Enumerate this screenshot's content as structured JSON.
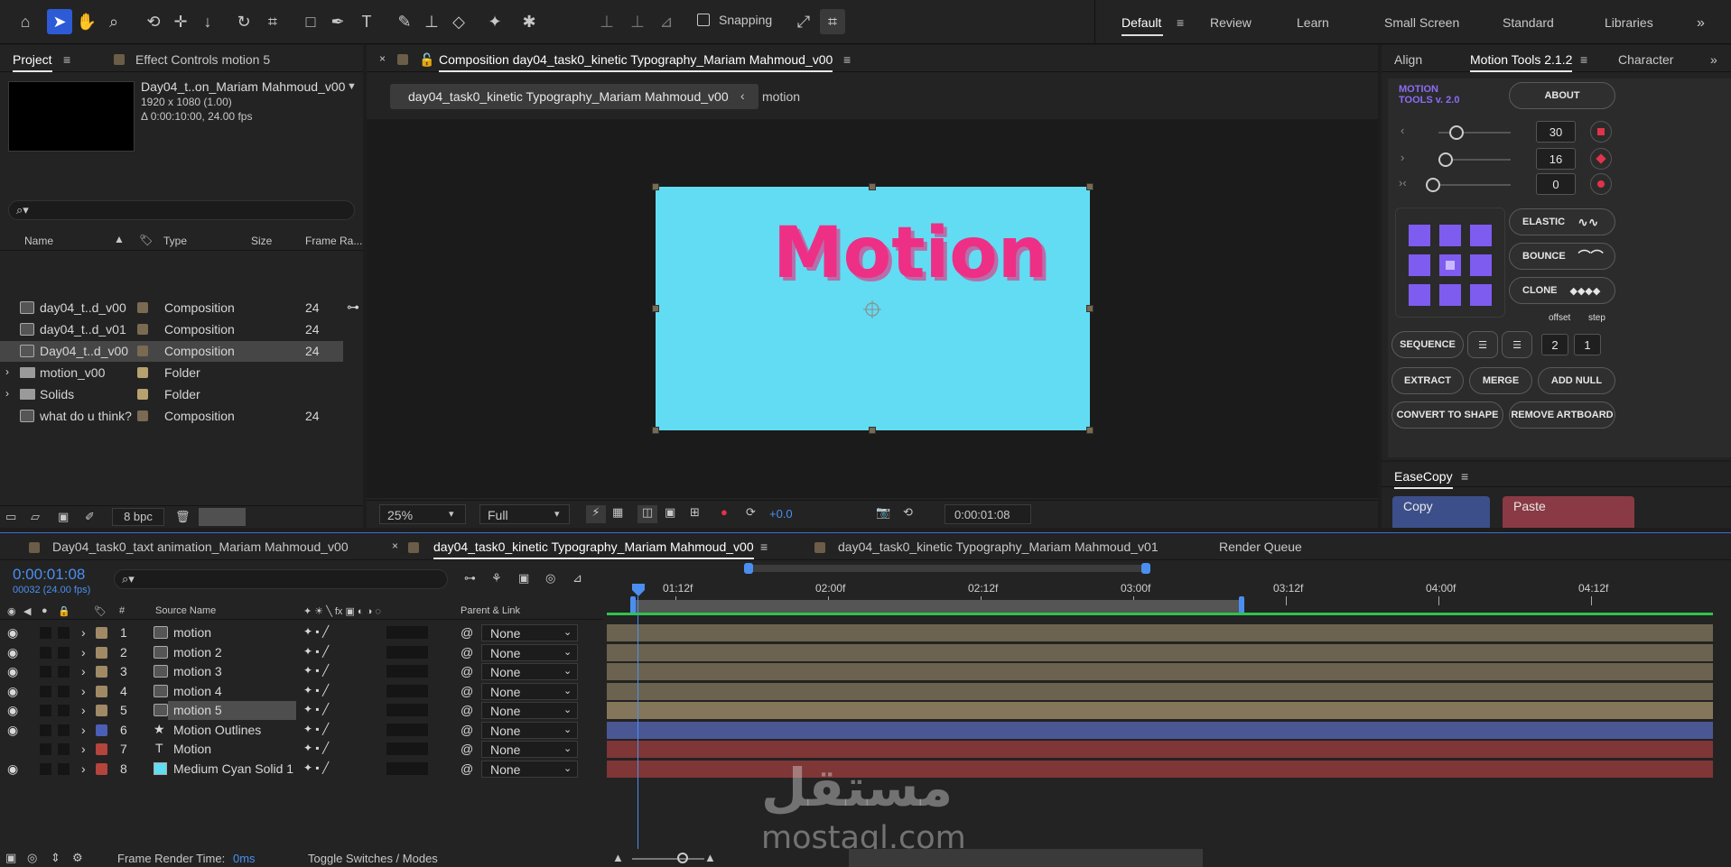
{
  "toolbar": {
    "snapping_label": "Snapping",
    "workspaces": [
      "Default",
      "Review",
      "Learn",
      "Small Screen",
      "Standard",
      "Libraries"
    ],
    "active_workspace": "Default"
  },
  "project": {
    "tabs": [
      "Project",
      "Effect Controls motion 5"
    ],
    "preview_name": "Day04_t..on_Mariam Mahmoud_v00",
    "preview_dims": "1920 x 1080 (1.00)",
    "preview_duration": "Δ 0:00:10:00, 24.00 fps",
    "search_placeholder": "",
    "columns": [
      "Name",
      "Type",
      "Size",
      "Frame Ra..."
    ],
    "items": [
      {
        "name": "day04_t..d_v00",
        "type": "Composition",
        "rate": "24",
        "kind": "comp",
        "color": "#7a6a52"
      },
      {
        "name": "day04_t..d_v01",
        "type": "Composition",
        "rate": "24",
        "kind": "comp",
        "color": "#7a6a52"
      },
      {
        "name": "Day04_t..d_v00",
        "type": "Composition",
        "rate": "24",
        "kind": "comp",
        "color": "#7a6a52",
        "selected": true
      },
      {
        "name": "motion_v00",
        "type": "Folder",
        "rate": "",
        "kind": "folder",
        "color": "#b7a26f"
      },
      {
        "name": "Solids",
        "type": "Folder",
        "rate": "",
        "kind": "folder",
        "color": "#b7a26f"
      },
      {
        "name": "what do u think?",
        "type": "Composition",
        "rate": "24",
        "kind": "comp",
        "color": "#7a6a52"
      }
    ],
    "bpc": "8 bpc"
  },
  "comp": {
    "panel_title": "Composition day04_task0_kinetic Typography_Mariam Mahmoud_v00",
    "breadcrumb_active": "day04_task0_kinetic Typography_Mariam Mahmoud_v00",
    "breadcrumb_next": "motion",
    "canvas_text": "Motion",
    "zoom": "25%",
    "resolution": "Full",
    "exposure": "+0.0",
    "timecode": "0:00:01:08"
  },
  "right": {
    "tabs": [
      "Align",
      "Motion Tools 2.1.2",
      "Character"
    ],
    "logo_line1": "MOTION",
    "logo_line2": "TOOLS v. 2.0",
    "about": "ABOUT",
    "values": [
      "30",
      "16",
      "0"
    ],
    "elastic": "ELASTIC",
    "bounce": "BOUNCE",
    "clone": "CLONE",
    "offset": "offset",
    "step": "step",
    "sequence": "SEQUENCE",
    "offset_val": "2",
    "step_val": "1",
    "extract": "EXTRACT",
    "merge": "MERGE",
    "add_null": "ADD NULL",
    "convert": "CONVERT TO SHAPE",
    "remove": "REMOVE ARTBOARD",
    "easecopy_title": "EaseCopy",
    "copy": "Copy",
    "paste": "Paste"
  },
  "timeline": {
    "tabs": [
      "Day04_task0_taxt animation_Mariam Mahmoud_v00",
      "day04_task0_kinetic Typography_Mariam Mahmoud_v00",
      "day04_task0_kinetic Typography_Mariam Mahmoud_v01",
      "Render Queue"
    ],
    "timecode": "0:00:01:08",
    "frame_info": "00032 (24.00 fps)",
    "col_source": "Source Name",
    "col_parent": "Parent & Link",
    "ruler": [
      "01:12f",
      "02:00f",
      "02:12f",
      "03:00f",
      "03:12f",
      "04:00f",
      "04:12f"
    ],
    "layers": [
      {
        "num": "1",
        "name": "motion",
        "color": "#a08a66",
        "parent": "None",
        "bar": "#6b6350",
        "kind": "comp"
      },
      {
        "num": "2",
        "name": "motion 2",
        "color": "#a08a66",
        "parent": "None",
        "bar": "#6b6350",
        "kind": "comp"
      },
      {
        "num": "3",
        "name": "motion 3",
        "color": "#a08a66",
        "parent": "None",
        "bar": "#6b6350",
        "kind": "comp"
      },
      {
        "num": "4",
        "name": "motion 4",
        "color": "#a08a66",
        "parent": "None",
        "bar": "#6b6350",
        "kind": "comp"
      },
      {
        "num": "5",
        "name": "motion 5",
        "color": "#a08a66",
        "parent": "None",
        "bar": "#84765a",
        "kind": "comp",
        "selected": true
      },
      {
        "num": "6",
        "name": "Motion Outlines",
        "color": "#4b5fb7",
        "parent": "None",
        "bar": "#4b5793",
        "kind": "shape"
      },
      {
        "num": "7",
        "name": "Motion",
        "color": "#b5443c",
        "parent": "None",
        "bar": "#7e3636",
        "kind": "text"
      },
      {
        "num": "8",
        "name": "Medium Cyan Solid 1",
        "color": "#b5443c",
        "parent": "None",
        "bar": "#7e3636",
        "kind": "solid"
      }
    ],
    "footer_render": "Frame Render Time:",
    "footer_render_val": "0ms",
    "footer_toggle": "Toggle Switches / Modes",
    "watermark_ar": "مستقل",
    "watermark_en": "mostaql.com"
  }
}
